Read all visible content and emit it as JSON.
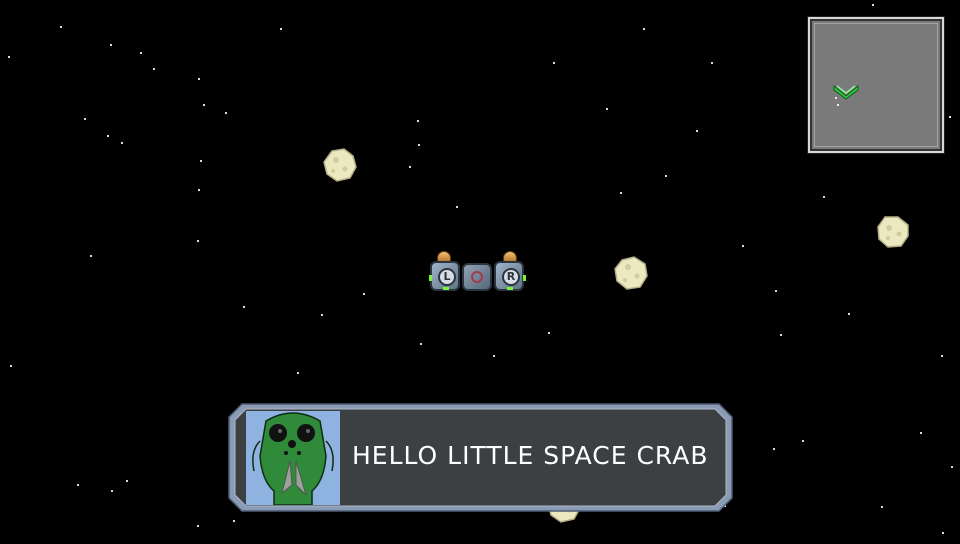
{
  "dialog": {
    "text": "HELLO LITTLE SPACE CRAB",
    "speaker_icon": "alien-portrait"
  },
  "ship": {
    "left_module_label": "L",
    "right_module_label": "R"
  },
  "minimap": {
    "player_marker_icon": "chevron-down-icon",
    "marker_color": "#2ecc40"
  },
  "colors": {
    "background": "#000000",
    "dialog_frame": "#8a9bb5",
    "dialog_fill": "#3c4043",
    "asteroid": "#e9e6bc",
    "minimap_fill": "#7a7a7a"
  }
}
